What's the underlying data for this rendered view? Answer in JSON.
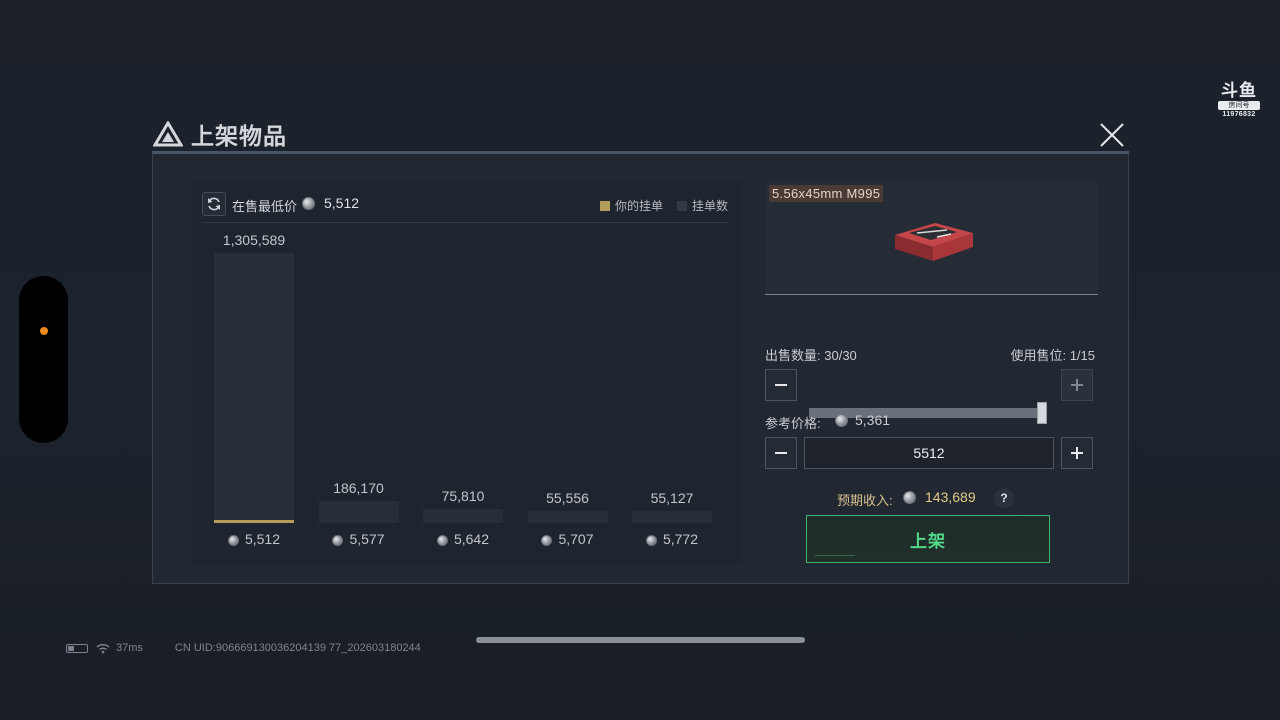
{
  "title": "上架物品",
  "watermark": {
    "mark": "斗鱼",
    "sub": "房间号",
    "number": "11976832"
  },
  "chart_header": {
    "lowest_label": "在售最低价",
    "lowest_value": "5,512",
    "legend_mine": "你的挂单",
    "legend_count": "挂单数",
    "legend_mine_color": "#b49d5b",
    "legend_count_color": "#343a44"
  },
  "chart_data": {
    "type": "bar",
    "categories": [
      "5,512",
      "5,577",
      "5,642",
      "5,707",
      "5,772"
    ],
    "values": [
      1305589,
      186170,
      75810,
      55556,
      55127
    ],
    "value_labels": [
      "1,305,589",
      "186,170",
      "75,810",
      "55,556",
      "55,127"
    ],
    "highlighted_category": "5,512"
  },
  "item": {
    "name": "5.56x45mm M995"
  },
  "quantity": {
    "label": "出售数量:",
    "value": "30/30",
    "fraction": 1.0
  },
  "slots": {
    "label": "使用售位:",
    "value": "1/15"
  },
  "reference": {
    "label": "参考价格:",
    "value": "5,361"
  },
  "price_input": {
    "value": "5512"
  },
  "income": {
    "label": "预期收入:",
    "value": "143,689",
    "help": "?"
  },
  "list_button": "上架",
  "status": {
    "ping": "37ms",
    "uid": "CN UID:906669130036204139 77_202603180244"
  }
}
